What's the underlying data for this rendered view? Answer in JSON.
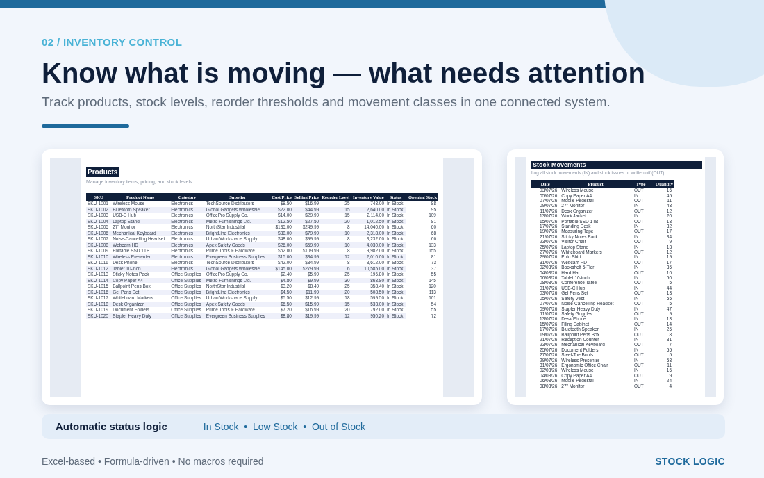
{
  "eyebrow": "02 / INVENTORY CONTROL",
  "title": "Know what is moving — what needs attention",
  "subtitle": "Track products, stock levels, reorder thresholds and movement classes in one connected system.",
  "products_sheet": {
    "title": "Products",
    "subtitle": "Manage inventory items, pricing, and stock levels.",
    "columns": [
      "SKU",
      "Product Name",
      "Category",
      "Supplier",
      "Cost Price",
      "Selling Price",
      "Reorder Level",
      "Inventory Value",
      "Status",
      "Opening Stock"
    ],
    "rows": [
      [
        "SKU-1001",
        "Wireless Mouse",
        "Electronics",
        "TechSource Distributors",
        "$8.50",
        "$16.99",
        "25",
        "748.00",
        "In Stock",
        "88"
      ],
      [
        "SKU-1002",
        "Bluetooth Speaker",
        "Electronics",
        "Global Gadgets Wholesale",
        "$22.00",
        "$44.99",
        "15",
        "2,640.00",
        "In Stock",
        "95"
      ],
      [
        "SKU-1003",
        "USB-C Hub",
        "Electronics",
        "OfficePro Supply Co.",
        "$14.00",
        "$29.99",
        "15",
        "2,114.00",
        "In Stock",
        "109"
      ],
      [
        "SKU-1004",
        "Laptop Stand",
        "Electronics",
        "Metro Furnishings Ltd.",
        "$12.50",
        "$27.50",
        "20",
        "1,012.50",
        "In Stock",
        "81"
      ],
      [
        "SKU-1005",
        "27\" Monitor",
        "Electronics",
        "NorthStar Industrial",
        "$135.00",
        "$249.99",
        "8",
        "14,040.00",
        "In Stock",
        "60"
      ],
      [
        "SKU-1006",
        "Mechanical Keyboard",
        "Electronics",
        "BrightLine Electronics",
        "$38.00",
        "$79.99",
        "10",
        "2,318.00",
        "In Stock",
        "68"
      ],
      [
        "SKU-1007",
        "Noise-Cancelling Headset",
        "Electronics",
        "Urban Workspace Supply",
        "$48.00",
        "$99.99",
        "8",
        "3,232.00",
        "In Stock",
        "66"
      ],
      [
        "SKU-1008",
        "Webcam HD",
        "Electronics",
        "Apex Safety Goods",
        "$26.00",
        "$59.99",
        "10",
        "4,030.00",
        "In Stock",
        "133"
      ],
      [
        "SKU-1009",
        "Portable SSD 1TB",
        "Electronics",
        "Prime Tools & Hardware",
        "$62.00",
        "$109.99",
        "8",
        "9,982.00",
        "In Stock",
        "155"
      ],
      [
        "SKU-1010",
        "Wireless Presenter",
        "Electronics",
        "Evergreen Business Supplies",
        "$15.00",
        "$34.99",
        "12",
        "2,010.00",
        "In Stock",
        "81"
      ],
      [
        "SKU-1011",
        "Desk Phone",
        "Electronics",
        "TechSource Distributors",
        "$42.00",
        "$84.99",
        "8",
        "3,612.00",
        "In Stock",
        "73"
      ],
      [
        "SKU-1012",
        "Tablet 10-inch",
        "Electronics",
        "Global Gadgets Wholesale",
        "$145.00",
        "$279.99",
        "6",
        "10,585.00",
        "In Stock",
        "37"
      ],
      [
        "SKU-1013",
        "Sticky Notes Pack",
        "Office Supplies",
        "OfficePro Supply Co.",
        "$2.40",
        "$5.99",
        "25",
        "196.80",
        "In Stock",
        "55"
      ],
      [
        "SKU-1014",
        "Copy Paper A4",
        "Office Supplies",
        "Metro Furnishings Ltd.",
        "$4.80",
        "$9.99",
        "30",
        "868.80",
        "In Stock",
        "145"
      ],
      [
        "SKU-1015",
        "Ballpoint Pens Box",
        "Office Supplies",
        "NorthStar Industrial",
        "$3.20",
        "$8.49",
        "25",
        "358.40",
        "In Stock",
        "120"
      ],
      [
        "SKU-1016",
        "Gel Pens Set",
        "Office Supplies",
        "BrightLine Electronics",
        "$4.50",
        "$11.99",
        "20",
        "508.50",
        "In Stock",
        "113"
      ],
      [
        "SKU-1017",
        "Whiteboard Markers",
        "Office Supplies",
        "Urban Workspace Supply",
        "$5.50",
        "$12.99",
        "18",
        "599.50",
        "In Stock",
        "101"
      ],
      [
        "SKU-1018",
        "Desk Organizer",
        "Office Supplies",
        "Apex Safety Goods",
        "$6.50",
        "$15.99",
        "15",
        "533.00",
        "In Stock",
        "54"
      ],
      [
        "SKU-1019",
        "Document Folders",
        "Office Supplies",
        "Prime Tools & Hardware",
        "$7.20",
        "$16.99",
        "20",
        "792.00",
        "In Stock",
        "55"
      ],
      [
        "SKU-1020",
        "Stapler Heavy Duty",
        "Office Supplies",
        "Evergreen Business Supplies",
        "$8.80",
        "$19.99",
        "12",
        "950.20",
        "In Stock",
        "72"
      ]
    ]
  },
  "movements_sheet": {
    "title": "Stock Movements",
    "subtitle": "Log all stock movements (IN) and stock issues or written off (OUT).",
    "columns": [
      "Date",
      "Product",
      "Type",
      "Quantity"
    ],
    "rows": [
      [
        "03/07/26",
        "Wireless Mouse",
        "OUT",
        "16"
      ],
      [
        "05/07/26",
        "Copy Paper A4",
        "IN",
        "45"
      ],
      [
        "07/07/26",
        "Mobile Pedestal",
        "OUT",
        "11"
      ],
      [
        "09/07/26",
        "27\" Monitor",
        "IN",
        "48"
      ],
      [
        "11/07/26",
        "Desk Organizer",
        "OUT",
        "12"
      ],
      [
        "13/07/26",
        "Work Jacket",
        "IN",
        "20"
      ],
      [
        "15/07/26",
        "Portable SSD 1TB",
        "OUT",
        "13"
      ],
      [
        "17/07/26",
        "Standing Desk",
        "IN",
        "32"
      ],
      [
        "19/07/26",
        "Measuring Tape",
        "OUT",
        "17"
      ],
      [
        "21/07/26",
        "Sticky Notes Pack",
        "IN",
        "34"
      ],
      [
        "23/07/26",
        "Visitor Chair",
        "OUT",
        "9"
      ],
      [
        "25/07/26",
        "Laptop Stand",
        "IN",
        "13"
      ],
      [
        "27/07/26",
        "Whiteboard Markers",
        "OUT",
        "12"
      ],
      [
        "29/07/26",
        "Polo Shirt",
        "IN",
        "19"
      ],
      [
        "31/07/26",
        "Webcam HD",
        "OUT",
        "17"
      ],
      [
        "02/08/26",
        "Bookshelf 5-Tier",
        "IN",
        "35"
      ],
      [
        "04/08/26",
        "Hard Hat",
        "OUT",
        "16"
      ],
      [
        "06/08/26",
        "Tablet 10-inch",
        "IN",
        "50"
      ],
      [
        "08/08/26",
        "Conference Table",
        "OUT",
        "5"
      ],
      [
        "01/07/26",
        "USB-C Hub",
        "IN",
        "44"
      ],
      [
        "03/07/26",
        "Gel Pens Set",
        "OUT",
        "13"
      ],
      [
        "05/07/26",
        "Safety Vest",
        "IN",
        "55"
      ],
      [
        "07/07/26",
        "Noise-Cancelling Headset",
        "OUT",
        "5"
      ],
      [
        "09/07/26",
        "Stapler Heavy Duty",
        "IN",
        "47"
      ],
      [
        "11/07/26",
        "Safety Goggles",
        "OUT",
        "9"
      ],
      [
        "13/07/26",
        "Desk Phone",
        "IN",
        "13"
      ],
      [
        "15/07/26",
        "Filing Cabinet",
        "OUT",
        "14"
      ],
      [
        "17/07/26",
        "Bluetooth Speaker",
        "IN",
        "25"
      ],
      [
        "19/07/26",
        "Ballpoint Pens Box",
        "OUT",
        "8"
      ],
      [
        "21/07/26",
        "Reception Counter",
        "IN",
        "31"
      ],
      [
        "23/07/26",
        "Mechanical Keyboard",
        "OUT",
        "7"
      ],
      [
        "25/07/26",
        "Document Folders",
        "IN",
        "55"
      ],
      [
        "27/07/26",
        "Steel-Toe Boots",
        "OUT",
        "5"
      ],
      [
        "29/07/26",
        "Wireless Presenter",
        "IN",
        "53"
      ],
      [
        "31/07/26",
        "Ergonomic Office Chair",
        "OUT",
        "11"
      ],
      [
        "02/08/26",
        "Wireless Mouse",
        "IN",
        "16"
      ],
      [
        "04/08/26",
        "Copy Paper A4",
        "OUT",
        "9"
      ],
      [
        "06/08/26",
        "Mobile Pedestal",
        "IN",
        "24"
      ],
      [
        "08/08/26",
        "27\" Monitor",
        "OUT",
        "4"
      ]
    ]
  },
  "status_strip": {
    "label": "Automatic status logic",
    "statuses": "In Stock  •  Low Stock  •  Out of Stock"
  },
  "footer": {
    "note": "Excel-based • Formula-driven • No macros required",
    "brand": "STOCK LOGIC"
  }
}
